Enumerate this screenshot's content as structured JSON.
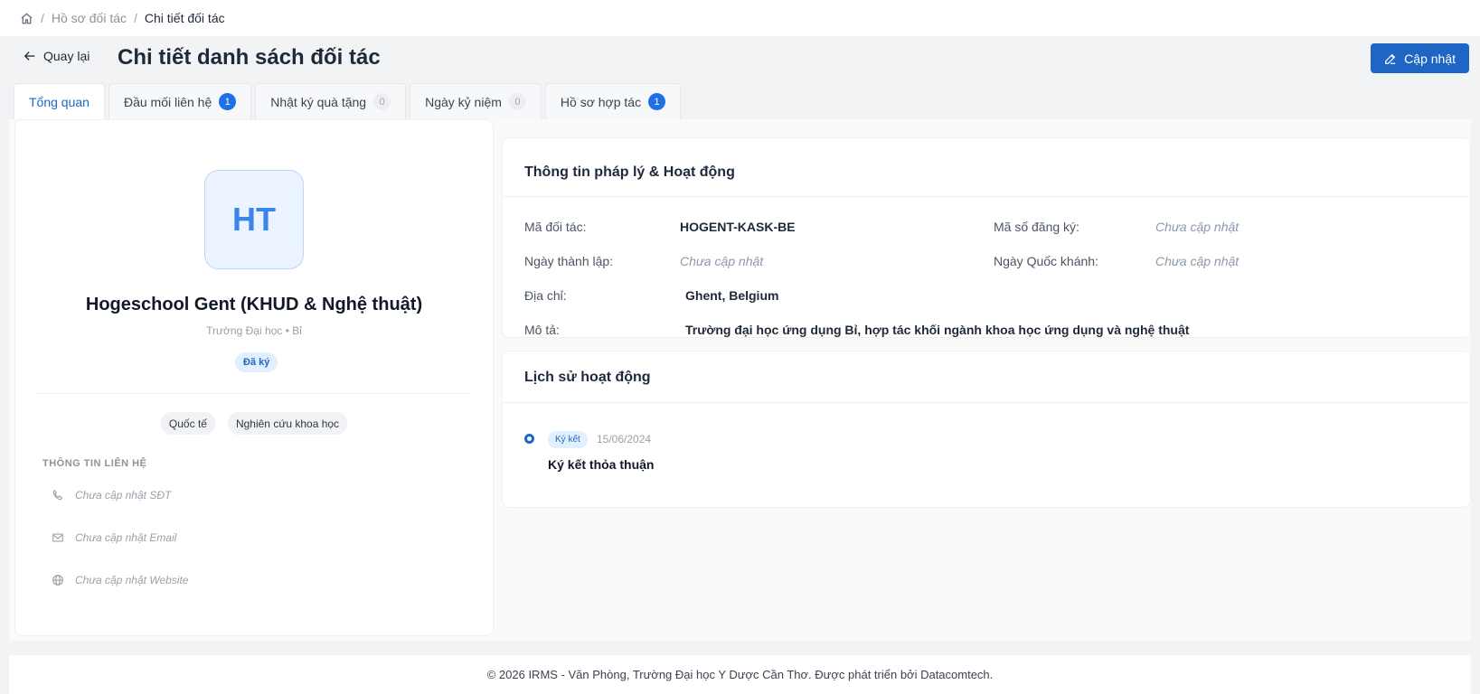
{
  "breadcrumb": {
    "items": [
      "Hồ sơ đối tác",
      "Chi tiết đối tác"
    ],
    "home_icon": "home-icon"
  },
  "header": {
    "back_label": "Quay lại",
    "title": "Chi tiết danh sách đối tác",
    "update_label": "Cập nhật"
  },
  "tabs": [
    {
      "label": "Tổng quan",
      "count": null,
      "active": true
    },
    {
      "label": "Đầu mối liên hệ",
      "count": "1"
    },
    {
      "label": "Nhật ký quà tặng",
      "count": "0"
    },
    {
      "label": "Ngày kỷ niệm",
      "count": "0"
    },
    {
      "label": "Hồ sơ hợp tác",
      "count": "1"
    }
  ],
  "profile": {
    "initials": "HT",
    "name": "Hogeschool Gent (KHUD & Nghệ thuật)",
    "subtitle": "Trường Đại học • Bỉ",
    "status": "Đã ký",
    "tags": [
      "Quốc tế",
      "Nghiên cứu khoa học"
    ],
    "contact_section_label": "THÔNG TIN LIÊN HỆ",
    "phone": "Chưa cập nhật SĐT",
    "email": "Chưa cập nhật Email",
    "website": "Chưa cập nhật Website"
  },
  "legal": {
    "title": "Thông tin pháp lý & Hoạt động",
    "partner_code_label": "Mã đối tác:",
    "partner_code": "HOGENT-KASK-BE",
    "reg_no_label": "Mã số đăng ký:",
    "reg_no": "Chưa cập nhật",
    "founded_label": "Ngày thành lập:",
    "founded": "Chưa cập nhật",
    "national_day_label": "Ngày Quốc khánh:",
    "national_day": "Chưa cập nhật",
    "address_label": "Địa chỉ:",
    "address": "Ghent, Belgium",
    "description_label": "Mô tả:",
    "description": "Trường đại học ứng dụng Bỉ, hợp tác khối ngành khoa học ứng dụng và nghệ thuật"
  },
  "history": {
    "title": "Lịch sử hoạt động",
    "items": [
      {
        "badge": "Ký kết",
        "date": "15/06/2024",
        "title": "Ký kết thỏa thuận"
      }
    ]
  },
  "footer": {
    "text": "© 2026 IRMS - Văn Phòng, Trường Đại học Y Dược Cần Thơ. Được phát triển bởi Datacomtech."
  },
  "colors": {
    "primary": "#1f66c4",
    "badge_blue": "#1f6fe5",
    "avatar_bg": "#eaf3ff"
  }
}
